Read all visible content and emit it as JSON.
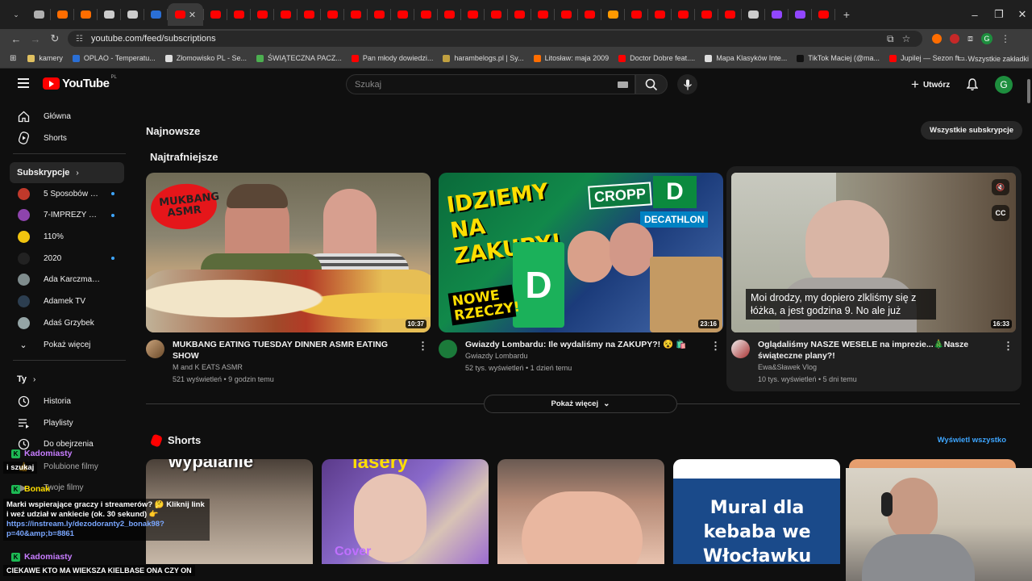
{
  "browser": {
    "tabs": [
      {
        "color": "#b0b0b0"
      },
      {
        "color": "#ff6d00"
      },
      {
        "color": "#ff6d00"
      },
      {
        "color": "#cccccc"
      },
      {
        "color": "#cccccc"
      },
      {
        "color": "#2a6fd6"
      },
      {
        "color": "#ff0000",
        "active": true
      },
      {
        "color": "#ff0000"
      },
      {
        "color": "#ff0000"
      },
      {
        "color": "#ff0000"
      },
      {
        "color": "#ff0000"
      },
      {
        "color": "#ff0000"
      },
      {
        "color": "#ff0000"
      },
      {
        "color": "#ff0000"
      },
      {
        "color": "#ff0000"
      },
      {
        "color": "#ff0000"
      },
      {
        "color": "#ff0000"
      },
      {
        "color": "#ff0000"
      },
      {
        "color": "#ff0000"
      },
      {
        "color": "#ff0000"
      },
      {
        "color": "#ff0000"
      },
      {
        "color": "#ff0000"
      },
      {
        "color": "#ff0000"
      },
      {
        "color": "#ff0000"
      },
      {
        "color": "#ff9900"
      },
      {
        "color": "#ff0000"
      },
      {
        "color": "#ff0000"
      },
      {
        "color": "#ff0000"
      },
      {
        "color": "#ff0000"
      },
      {
        "color": "#ff0000"
      },
      {
        "color": "#cccccc"
      },
      {
        "color": "#9146ff"
      },
      {
        "color": "#9146ff"
      },
      {
        "color": "#ff0000"
      }
    ],
    "url": "youtube.com/feed/subscriptions",
    "bookmarks": [
      {
        "label": "kamery",
        "color": "#e0c060"
      },
      {
        "label": "OPLAO - Temperatu...",
        "color": "#2a6fd6"
      },
      {
        "label": "Złomowisko PL - Se...",
        "color": "#dddddd"
      },
      {
        "label": "ŚWIĄTECZNA PACZ...",
        "color": "#4caf50"
      },
      {
        "label": "Pan młody dowiedzi...",
        "color": "#ff0000"
      },
      {
        "label": "harambelogs.pl | Sy...",
        "color": "#c0a040"
      },
      {
        "label": "Litosław: maja 2009",
        "color": "#ff6d00"
      },
      {
        "label": "Doctor Dobre feat....",
        "color": "#ff0000"
      },
      {
        "label": "Mapa Klasyków Inte...",
        "color": "#dddddd"
      },
      {
        "label": "TikTok Maciej (@ma...",
        "color": "#111111"
      },
      {
        "label": "Jupilej — Sezon ft....",
        "color": "#ff0000"
      }
    ],
    "all_bookmarks": "Wszystkie zakładki"
  },
  "header": {
    "logo_text": "YouTube",
    "logo_country": "PL",
    "search_placeholder": "Szukaj",
    "create_label": "Utwórz",
    "avatar_letter": "G"
  },
  "sidebar": {
    "main_items": [
      {
        "label": "Główna",
        "icon": "home-icon"
      },
      {
        "label": "Shorts",
        "icon": "shorts-icon"
      }
    ],
    "subs_header": "Subskrypcje",
    "subscriptions": [
      {
        "label": "5 Sposobów na...",
        "color": "#c0392b",
        "live": true
      },
      {
        "label": "7-IMPREZY ELBL...",
        "color": "#8e44ad",
        "live": true
      },
      {
        "label": "110%",
        "color": "#f1c40f",
        "live": false
      },
      {
        "label": "2020",
        "color": "#222222",
        "live": true
      },
      {
        "label": "Ada Karczmarczyk",
        "color": "#7f8c8d",
        "live": false
      },
      {
        "label": "Adamek TV",
        "color": "#2c3e50",
        "live": false
      },
      {
        "label": "Adaś Grzybek",
        "color": "#95a5a6",
        "live": false
      }
    ],
    "show_more": "Pokaż więcej",
    "you_header": "Ty",
    "you_items": [
      {
        "label": "Historia",
        "icon": "history-icon"
      },
      {
        "label": "Playlisty",
        "icon": "playlist-icon"
      },
      {
        "label": "Do obejrzenia",
        "icon": "watch-later-icon"
      },
      {
        "label": "Polubione filmy",
        "icon": "like-icon"
      },
      {
        "label": "Twoje filmy",
        "icon": "video-icon"
      }
    ]
  },
  "main": {
    "newest_title": "Najnowsze",
    "relevant_title": "Najtrafniejsze",
    "all_subs_button": "Wszystkie subskrypcje",
    "videos": [
      {
        "title": "MUKBANG EATING TUESDAY DINNER ASMR EATING SHOW",
        "channel": "M and K EATS ASMR",
        "stats": "521 wyświetleń • 9 godzin temu",
        "duration": "10:37",
        "thumb_text": "MUKBANG ASMR"
      },
      {
        "title": "Gwiazdy Lombardu: Ile wydaliśmy na ZAKUPY?! 😵 🛍️",
        "channel": "Gwiazdy Lombardu",
        "stats": "52 tys. wyświetleń • 1 dzień temu",
        "duration": "23:16",
        "thumb_top": "IDZIEMY NA ZAKUPY!",
        "thumb_bottom": "NOWE RZECZY!",
        "store1": "CROPP",
        "store2": "DECATHLON",
        "store3": "DEICHMANN"
      },
      {
        "title": "Oglądaliśmy NASZE WESELE na imprezie...🎄Nasze świąteczne plany?!",
        "channel": "Ewa&Sławek Vlog",
        "stats": "10 tys. wyświetleń • 5 dni temu",
        "duration": "16:33",
        "caption": "Moi drodzy, my dopiero zlkliśmy się z łóżka, a jest godzina 9. No ale już"
      }
    ],
    "show_more_button": "Pokaż więcej",
    "shorts_title": "Shorts",
    "view_all": "Wyświetl wszystko",
    "shorts": [
      {
        "text": "wypalanie"
      },
      {
        "text": "lasery",
        "overlay": "Cover"
      },
      {
        "text": ""
      },
      {
        "text": "Mural dla kebaba we Włocławku"
      },
      {
        "text": ""
      }
    ]
  },
  "stream_overlay": {
    "chat": [
      {
        "user": "Kadomiasty",
        "message": "i szukaj"
      },
      {
        "user": "Bonak",
        "message": "Marki wspierające graczy i streamerów? 🤔 Kliknij link i weź udział w ankiecie (ok. 30 sekund) 👉",
        "link": "https://instream.ly/dezodoranty2_bonak98?p=40&amp;b=8861"
      },
      {
        "user": "Kadomiasty",
        "message": "CIEKAWE KTO MA WIEKSZA KIELBASE ONA CZY ON"
      }
    ]
  }
}
